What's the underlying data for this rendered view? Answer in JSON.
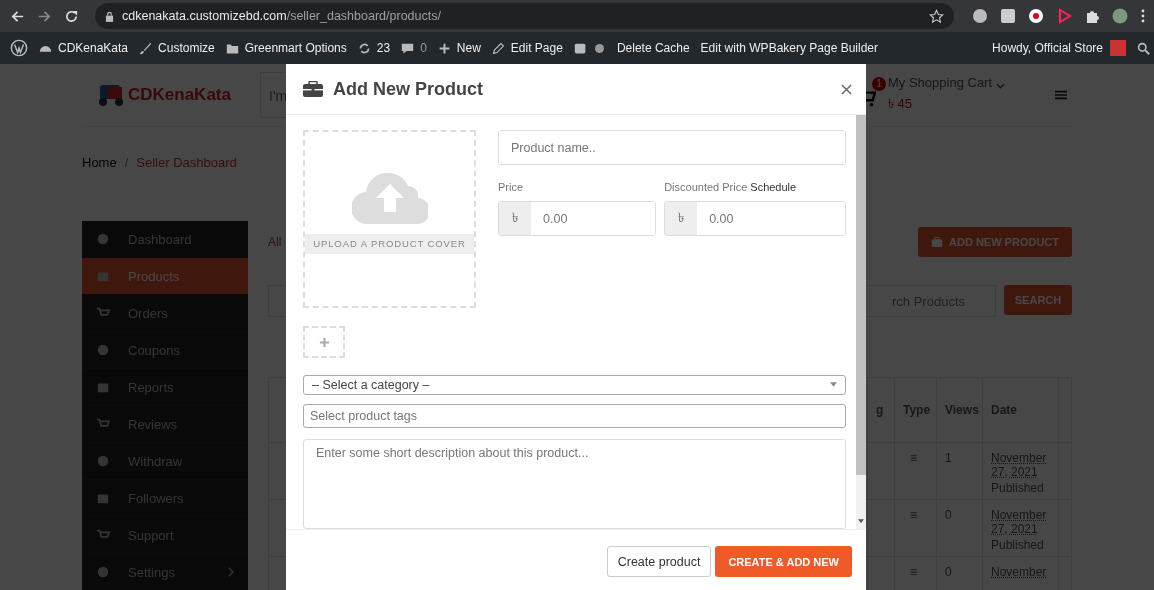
{
  "browser": {
    "url_host": "cdkenakata.customizebd.com",
    "url_path": "/seller_dashboard/products/"
  },
  "admin_bar": {
    "items": [
      {
        "kind": "site",
        "label": "CDKenaKata"
      },
      {
        "kind": "customize",
        "label": "Customize"
      },
      {
        "kind": "options",
        "label": "Greenmart Options"
      },
      {
        "kind": "updates",
        "label": "23"
      },
      {
        "kind": "comments",
        "label": "0"
      },
      {
        "kind": "new",
        "label": "New"
      },
      {
        "kind": "edit",
        "label": "Edit Page"
      },
      {
        "kind": "seo"
      },
      {
        "kind": "plain",
        "label": "Delete Cache"
      },
      {
        "kind": "plain",
        "label": "Edit with WPBakery Page Builder"
      }
    ],
    "greeting": "Howdy, Official Store"
  },
  "header": {
    "logo": "CDKenaKata",
    "search_text": "I'm",
    "cart": {
      "badge": "1",
      "title": "My Shopping Cart",
      "total": "৳ 45"
    }
  },
  "breadcrumb": {
    "home": "Home",
    "separator": "/",
    "current": "Seller Dashboard"
  },
  "sidebar": {
    "items": [
      {
        "label": "Dashboard",
        "selected": false,
        "submenu": false
      },
      {
        "label": "Products",
        "selected": true,
        "submenu": false
      },
      {
        "label": "Orders",
        "selected": false,
        "submenu": false
      },
      {
        "label": "Coupons",
        "selected": false,
        "submenu": false
      },
      {
        "label": "Reports",
        "selected": false,
        "submenu": false
      },
      {
        "label": "Reviews",
        "selected": false,
        "submenu": false
      },
      {
        "label": "Withdraw",
        "selected": false,
        "submenu": false
      },
      {
        "label": "Followers",
        "selected": false,
        "submenu": false
      },
      {
        "label": "Support",
        "selected": false,
        "submenu": false
      },
      {
        "label": "Settings",
        "selected": false,
        "submenu": true
      }
    ]
  },
  "content": {
    "filter": "All",
    "add_button": "ADD NEW PRODUCT",
    "search": {
      "placeholder": "rch Products",
      "button": "SEARCH"
    },
    "table": {
      "columns": [
        "g",
        "Type",
        "Views",
        "Date"
      ],
      "rows": [
        {
          "type": "≡",
          "views": "1",
          "date": "November 27, 2021",
          "status": "Published"
        },
        {
          "type": "≡",
          "views": "0",
          "date": "November 27, 2021",
          "status": "Published"
        },
        {
          "type": "≡",
          "views": "0",
          "date": "November"
        }
      ]
    }
  },
  "modal": {
    "title": "Add New Product",
    "upload_label": "UPLOAD A PRODUCT COVER",
    "name_placeholder": "Product name..",
    "price_label": "Price",
    "discount_label": "Discounted Price",
    "schedule_link": "Schedule",
    "price": {
      "currency": "৳",
      "placeholder": "0.00"
    },
    "discount": {
      "currency": "৳",
      "placeholder": "0.00"
    },
    "category": "– Select a category –",
    "tags_placeholder": "Select product tags",
    "description_placeholder": "Enter some short description about this product...",
    "buttons": {
      "create": "Create product",
      "create_add": "CREATE & ADD NEW"
    }
  }
}
